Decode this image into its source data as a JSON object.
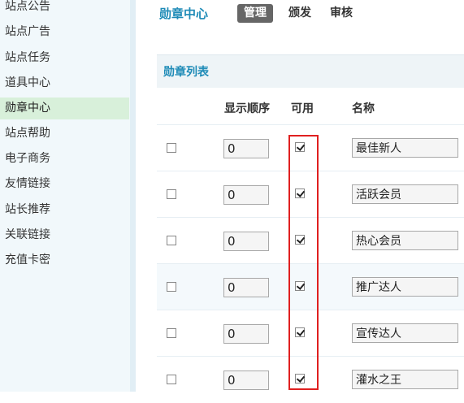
{
  "sidebar": {
    "items": [
      {
        "label": "站点公告",
        "active": false
      },
      {
        "label": "站点广告",
        "active": false
      },
      {
        "label": "站点任务",
        "active": false
      },
      {
        "label": "道具中心",
        "active": false
      },
      {
        "label": "勋章中心",
        "active": true
      },
      {
        "label": "站点帮助",
        "active": false
      },
      {
        "label": "电子商务",
        "active": false
      },
      {
        "label": "友情链接",
        "active": false
      },
      {
        "label": "站长推荐",
        "active": false
      },
      {
        "label": "关联链接",
        "active": false
      },
      {
        "label": "充值卡密",
        "active": false
      }
    ]
  },
  "header": {
    "title": "勋章中心",
    "tabs": [
      {
        "label": "管理",
        "active": true
      },
      {
        "label": "颁发",
        "active": false
      },
      {
        "label": "审核",
        "active": false
      }
    ]
  },
  "list": {
    "title": "勋章列表",
    "columns": {
      "order": "显示顺序",
      "available": "可用",
      "name": "名称"
    },
    "rows": [
      {
        "selected": false,
        "order": "0",
        "available": true,
        "name": "最佳新人"
      },
      {
        "selected": false,
        "order": "0",
        "available": true,
        "name": "活跃会员"
      },
      {
        "selected": false,
        "order": "0",
        "available": true,
        "name": "热心会员"
      },
      {
        "selected": false,
        "order": "0",
        "available": true,
        "name": "推广达人"
      },
      {
        "selected": false,
        "order": "0",
        "available": true,
        "name": "宣传达人"
      },
      {
        "selected": false,
        "order": "0",
        "available": true,
        "name": "灌水之王"
      }
    ]
  },
  "colors": {
    "accent": "#1e8bb7",
    "sidebar_bg": "#f1f8fb",
    "sidebar_active_bg": "#d8f0da",
    "highlight": "#e02020"
  }
}
